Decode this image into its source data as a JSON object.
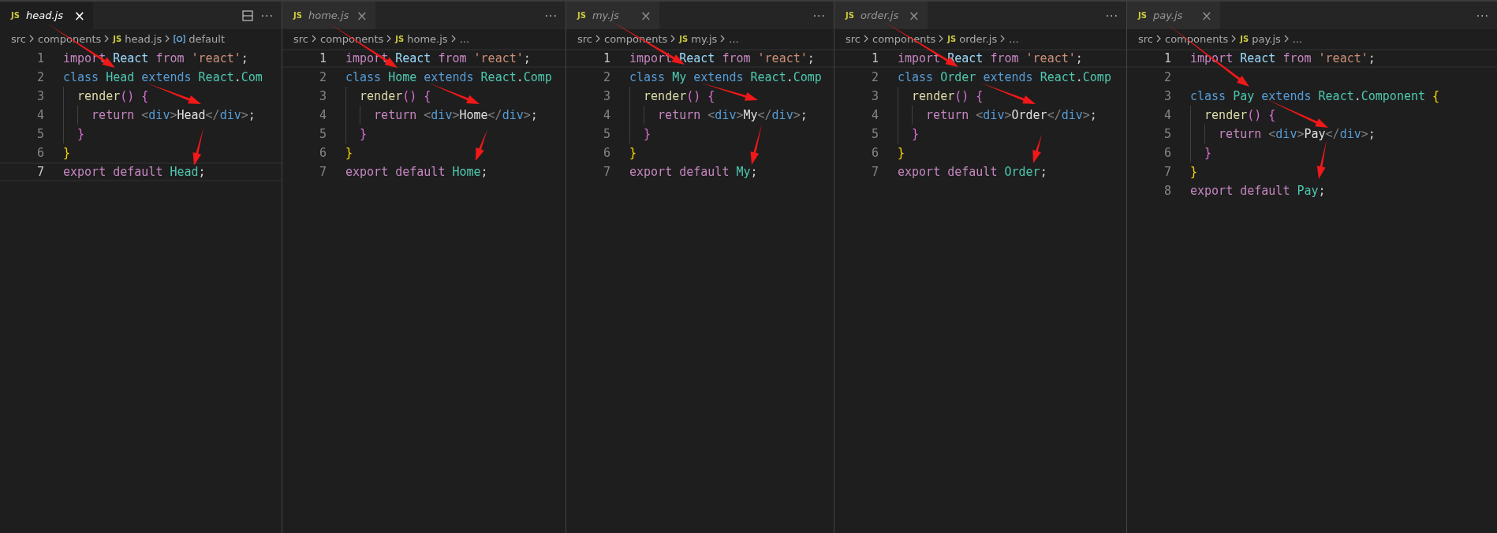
{
  "panes": [
    {
      "tab": {
        "icon": "JS",
        "label": "head.js",
        "close": "×",
        "selected": true
      },
      "split_editor": true,
      "more": "···",
      "breadcrumbs": [
        {
          "kind": "folder",
          "label": "src"
        },
        {
          "kind": "folder",
          "label": "components"
        },
        {
          "kind": "file",
          "icon": "JS",
          "label": "head.js"
        },
        {
          "kind": "symbol",
          "label": "default"
        }
      ],
      "lines": [
        {
          "number": "1",
          "current": false,
          "tokens": [
            {
              "text": "import ",
              "kind": "kw"
            },
            {
              "text": "React ",
              "kind": "var"
            },
            {
              "text": "from ",
              "kind": "kw"
            },
            {
              "text": "'react'",
              "kind": "str"
            },
            {
              "text": ";",
              "kind": "punc"
            }
          ]
        },
        {
          "number": "2",
          "current": false,
          "tokens": [
            {
              "text": "class ",
              "kind": "storage"
            },
            {
              "text": "Head ",
              "kind": "type"
            },
            {
              "text": "extends ",
              "kind": "storage"
            },
            {
              "text": "React",
              "kind": "type"
            },
            {
              "text": ".",
              "kind": "punc"
            },
            {
              "text": "Com",
              "kind": "type"
            }
          ]
        },
        {
          "number": "3",
          "current": false,
          "tokens": [
            {
              "text": "  render",
              "kind": "fn"
            },
            {
              "text": "() {",
              "kind": "br2"
            }
          ]
        },
        {
          "number": "4",
          "current": false,
          "tokens": [
            {
              "text": "    return ",
              "kind": "kw"
            },
            {
              "text": "<",
              "kind": "tagp"
            },
            {
              "text": "div",
              "kind": "tag"
            },
            {
              "text": ">",
              "kind": "tagp"
            },
            {
              "text": "Head",
              "kind": "text"
            },
            {
              "text": "</",
              "kind": "tagp"
            },
            {
              "text": "div",
              "kind": "tag"
            },
            {
              "text": ">",
              "kind": "tagp"
            },
            {
              "text": ";",
              "kind": "punc"
            }
          ]
        },
        {
          "number": "5",
          "current": false,
          "tokens": [
            {
              "text": "  }",
              "kind": "br2"
            }
          ]
        },
        {
          "number": "6",
          "current": false,
          "tokens": [
            {
              "text": "}",
              "kind": "br1"
            }
          ]
        },
        {
          "number": "7",
          "current": true,
          "tokens": [
            {
              "text": "export default ",
              "kind": "kw"
            },
            {
              "text": "Head",
              "kind": "type"
            },
            {
              "text": ";",
              "kind": "punc"
            }
          ]
        }
      ]
    },
    {
      "tab": {
        "icon": "JS",
        "label": "home.js",
        "close": "×",
        "selected": false
      },
      "split_editor": false,
      "more": "···",
      "breadcrumbs": [
        {
          "kind": "folder",
          "label": "src"
        },
        {
          "kind": "folder",
          "label": "components"
        },
        {
          "kind": "file",
          "icon": "JS",
          "label": "home.js"
        },
        {
          "kind": "more",
          "label": "..."
        }
      ],
      "lines": [
        {
          "number": "1",
          "current": true,
          "tokens": [
            {
              "text": "import ",
              "kind": "kw"
            },
            {
              "text": "React ",
              "kind": "var"
            },
            {
              "text": "from ",
              "kind": "kw"
            },
            {
              "text": "'react'",
              "kind": "str"
            },
            {
              "text": ";",
              "kind": "punc"
            }
          ]
        },
        {
          "number": "2",
          "current": false,
          "tokens": [
            {
              "text": "class ",
              "kind": "storage"
            },
            {
              "text": "Home ",
              "kind": "type"
            },
            {
              "text": "extends ",
              "kind": "storage"
            },
            {
              "text": "React",
              "kind": "type"
            },
            {
              "text": ".",
              "kind": "punc"
            },
            {
              "text": "Comp",
              "kind": "type"
            }
          ]
        },
        {
          "number": "3",
          "current": false,
          "tokens": [
            {
              "text": "  render",
              "kind": "fn"
            },
            {
              "text": "() {",
              "kind": "br2"
            }
          ]
        },
        {
          "number": "4",
          "current": false,
          "tokens": [
            {
              "text": "    return ",
              "kind": "kw"
            },
            {
              "text": "<",
              "kind": "tagp"
            },
            {
              "text": "div",
              "kind": "tag"
            },
            {
              "text": ">",
              "kind": "tagp"
            },
            {
              "text": "Home",
              "kind": "text"
            },
            {
              "text": "</",
              "kind": "tagp"
            },
            {
              "text": "div",
              "kind": "tag"
            },
            {
              "text": ">",
              "kind": "tagp"
            },
            {
              "text": ";",
              "kind": "punc"
            }
          ]
        },
        {
          "number": "5",
          "current": false,
          "tokens": [
            {
              "text": "  }",
              "kind": "br2"
            }
          ]
        },
        {
          "number": "6",
          "current": false,
          "tokens": [
            {
              "text": "}",
              "kind": "br1"
            }
          ]
        },
        {
          "number": "7",
          "current": false,
          "tokens": [
            {
              "text": "export default ",
              "kind": "kw"
            },
            {
              "text": "Home",
              "kind": "type"
            },
            {
              "text": ";",
              "kind": "punc"
            }
          ]
        }
      ]
    },
    {
      "tab": {
        "icon": "JS",
        "label": "my.js",
        "close": "×",
        "selected": false
      },
      "split_editor": false,
      "more": "···",
      "breadcrumbs": [
        {
          "kind": "folder",
          "label": "src"
        },
        {
          "kind": "folder",
          "label": "components"
        },
        {
          "kind": "file",
          "icon": "JS",
          "label": "my.js"
        },
        {
          "kind": "more",
          "label": "..."
        }
      ],
      "lines": [
        {
          "number": "1",
          "current": true,
          "tokens": [
            {
              "text": "import ",
              "kind": "kw"
            },
            {
              "text": "React ",
              "kind": "var"
            },
            {
              "text": "from ",
              "kind": "kw"
            },
            {
              "text": "'react'",
              "kind": "str"
            },
            {
              "text": ";",
              "kind": "punc"
            }
          ]
        },
        {
          "number": "2",
          "current": false,
          "tokens": [
            {
              "text": "class ",
              "kind": "storage"
            },
            {
              "text": "My ",
              "kind": "type"
            },
            {
              "text": "extends ",
              "kind": "storage"
            },
            {
              "text": "React",
              "kind": "type"
            },
            {
              "text": ".",
              "kind": "punc"
            },
            {
              "text": "Comp",
              "kind": "type"
            }
          ]
        },
        {
          "number": "3",
          "current": false,
          "tokens": [
            {
              "text": "  render",
              "kind": "fn"
            },
            {
              "text": "() {",
              "kind": "br2"
            }
          ]
        },
        {
          "number": "4",
          "current": false,
          "tokens": [
            {
              "text": "    return ",
              "kind": "kw"
            },
            {
              "text": "<",
              "kind": "tagp"
            },
            {
              "text": "div",
              "kind": "tag"
            },
            {
              "text": ">",
              "kind": "tagp"
            },
            {
              "text": "My",
              "kind": "text"
            },
            {
              "text": "</",
              "kind": "tagp"
            },
            {
              "text": "div",
              "kind": "tag"
            },
            {
              "text": ">",
              "kind": "tagp"
            },
            {
              "text": ";",
              "kind": "punc"
            }
          ]
        },
        {
          "number": "5",
          "current": false,
          "tokens": [
            {
              "text": "  }",
              "kind": "br2"
            }
          ]
        },
        {
          "number": "6",
          "current": false,
          "tokens": [
            {
              "text": "}",
              "kind": "br1"
            }
          ]
        },
        {
          "number": "7",
          "current": false,
          "tokens": [
            {
              "text": "export default ",
              "kind": "kw"
            },
            {
              "text": "My",
              "kind": "type"
            },
            {
              "text": ";",
              "kind": "punc"
            }
          ]
        }
      ]
    },
    {
      "tab": {
        "icon": "JS",
        "label": "order.js",
        "close": "×",
        "selected": false
      },
      "split_editor": false,
      "more": "···",
      "breadcrumbs": [
        {
          "kind": "folder",
          "label": "src"
        },
        {
          "kind": "folder",
          "label": "components"
        },
        {
          "kind": "file",
          "icon": "JS",
          "label": "order.js"
        },
        {
          "kind": "more",
          "label": "..."
        }
      ],
      "lines": [
        {
          "number": "1",
          "current": true,
          "tokens": [
            {
              "text": "import ",
              "kind": "kw"
            },
            {
              "text": "React ",
              "kind": "var"
            },
            {
              "text": "from ",
              "kind": "kw"
            },
            {
              "text": "'react'",
              "kind": "str"
            },
            {
              "text": ";",
              "kind": "punc"
            }
          ]
        },
        {
          "number": "2",
          "current": false,
          "tokens": [
            {
              "text": "class ",
              "kind": "storage"
            },
            {
              "text": "Order ",
              "kind": "type"
            },
            {
              "text": "extends ",
              "kind": "storage"
            },
            {
              "text": "React",
              "kind": "type"
            },
            {
              "text": ".",
              "kind": "punc"
            },
            {
              "text": "Comp",
              "kind": "type"
            }
          ]
        },
        {
          "number": "3",
          "current": false,
          "tokens": [
            {
              "text": "  render",
              "kind": "fn"
            },
            {
              "text": "() {",
              "kind": "br2"
            }
          ]
        },
        {
          "number": "4",
          "current": false,
          "tokens": [
            {
              "text": "    return ",
              "kind": "kw"
            },
            {
              "text": "<",
              "kind": "tagp"
            },
            {
              "text": "div",
              "kind": "tag"
            },
            {
              "text": ">",
              "kind": "tagp"
            },
            {
              "text": "Order",
              "kind": "text"
            },
            {
              "text": "</",
              "kind": "tagp"
            },
            {
              "text": "div",
              "kind": "tag"
            },
            {
              "text": ">",
              "kind": "tagp"
            },
            {
              "text": ";",
              "kind": "punc"
            }
          ]
        },
        {
          "number": "5",
          "current": false,
          "tokens": [
            {
              "text": "  }",
              "kind": "br2"
            }
          ]
        },
        {
          "number": "6",
          "current": false,
          "tokens": [
            {
              "text": "}",
              "kind": "br1"
            }
          ]
        },
        {
          "number": "7",
          "current": false,
          "tokens": [
            {
              "text": "export default ",
              "kind": "kw"
            },
            {
              "text": "Order",
              "kind": "type"
            },
            {
              "text": ";",
              "kind": "punc"
            }
          ]
        }
      ]
    },
    {
      "tab": {
        "icon": "JS",
        "label": "pay.js",
        "close": "×",
        "selected": false
      },
      "split_editor": false,
      "more": "···",
      "breadcrumbs": [
        {
          "kind": "folder",
          "label": "src"
        },
        {
          "kind": "folder",
          "label": "components"
        },
        {
          "kind": "file",
          "icon": "JS",
          "label": "pay.js"
        },
        {
          "kind": "more",
          "label": "..."
        }
      ],
      "lines": [
        {
          "number": "1",
          "current": true,
          "tokens": [
            {
              "text": "import ",
              "kind": "kw"
            },
            {
              "text": "React ",
              "kind": "var"
            },
            {
              "text": "from ",
              "kind": "kw"
            },
            {
              "text": "'react'",
              "kind": "str"
            },
            {
              "text": ";",
              "kind": "punc"
            }
          ]
        },
        {
          "number": "2",
          "current": false
        },
        {
          "number": "3",
          "current": false,
          "tokens": [
            {
              "text": "class ",
              "kind": "storage"
            },
            {
              "text": "Pay ",
              "kind": "type"
            },
            {
              "text": "extends ",
              "kind": "storage"
            },
            {
              "text": "React",
              "kind": "type"
            },
            {
              "text": ".",
              "kind": "punc"
            },
            {
              "text": "Component ",
              "kind": "type"
            },
            {
              "text": "{",
              "kind": "br1"
            }
          ]
        },
        {
          "number": "4",
          "current": false,
          "tokens": [
            {
              "text": "  render",
              "kind": "fn"
            },
            {
              "text": "() {",
              "kind": "br2"
            }
          ]
        },
        {
          "number": "5",
          "current": false,
          "tokens": [
            {
              "text": "    return ",
              "kind": "kw"
            },
            {
              "text": "<",
              "kind": "tagp"
            },
            {
              "text": "div",
              "kind": "tag"
            },
            {
              "text": ">",
              "kind": "tagp"
            },
            {
              "text": "Pay",
              "kind": "text"
            },
            {
              "text": "</",
              "kind": "tagp"
            },
            {
              "text": "div",
              "kind": "tag"
            },
            {
              "text": ">",
              "kind": "tagp"
            },
            {
              "text": ";",
              "kind": "punc"
            }
          ]
        },
        {
          "number": "6",
          "current": false,
          "tokens": [
            {
              "text": "  }",
              "kind": "br2"
            }
          ]
        },
        {
          "number": "7",
          "current": false,
          "tokens": [
            {
              "text": "}",
              "kind": "br1"
            }
          ]
        },
        {
          "number": "8",
          "current": false,
          "tokens": [
            {
              "text": "export default ",
              "kind": "kw"
            },
            {
              "text": "Pay",
              "kind": "type"
            },
            {
              "text": ";",
              "kind": "punc"
            }
          ]
        }
      ]
    }
  ]
}
